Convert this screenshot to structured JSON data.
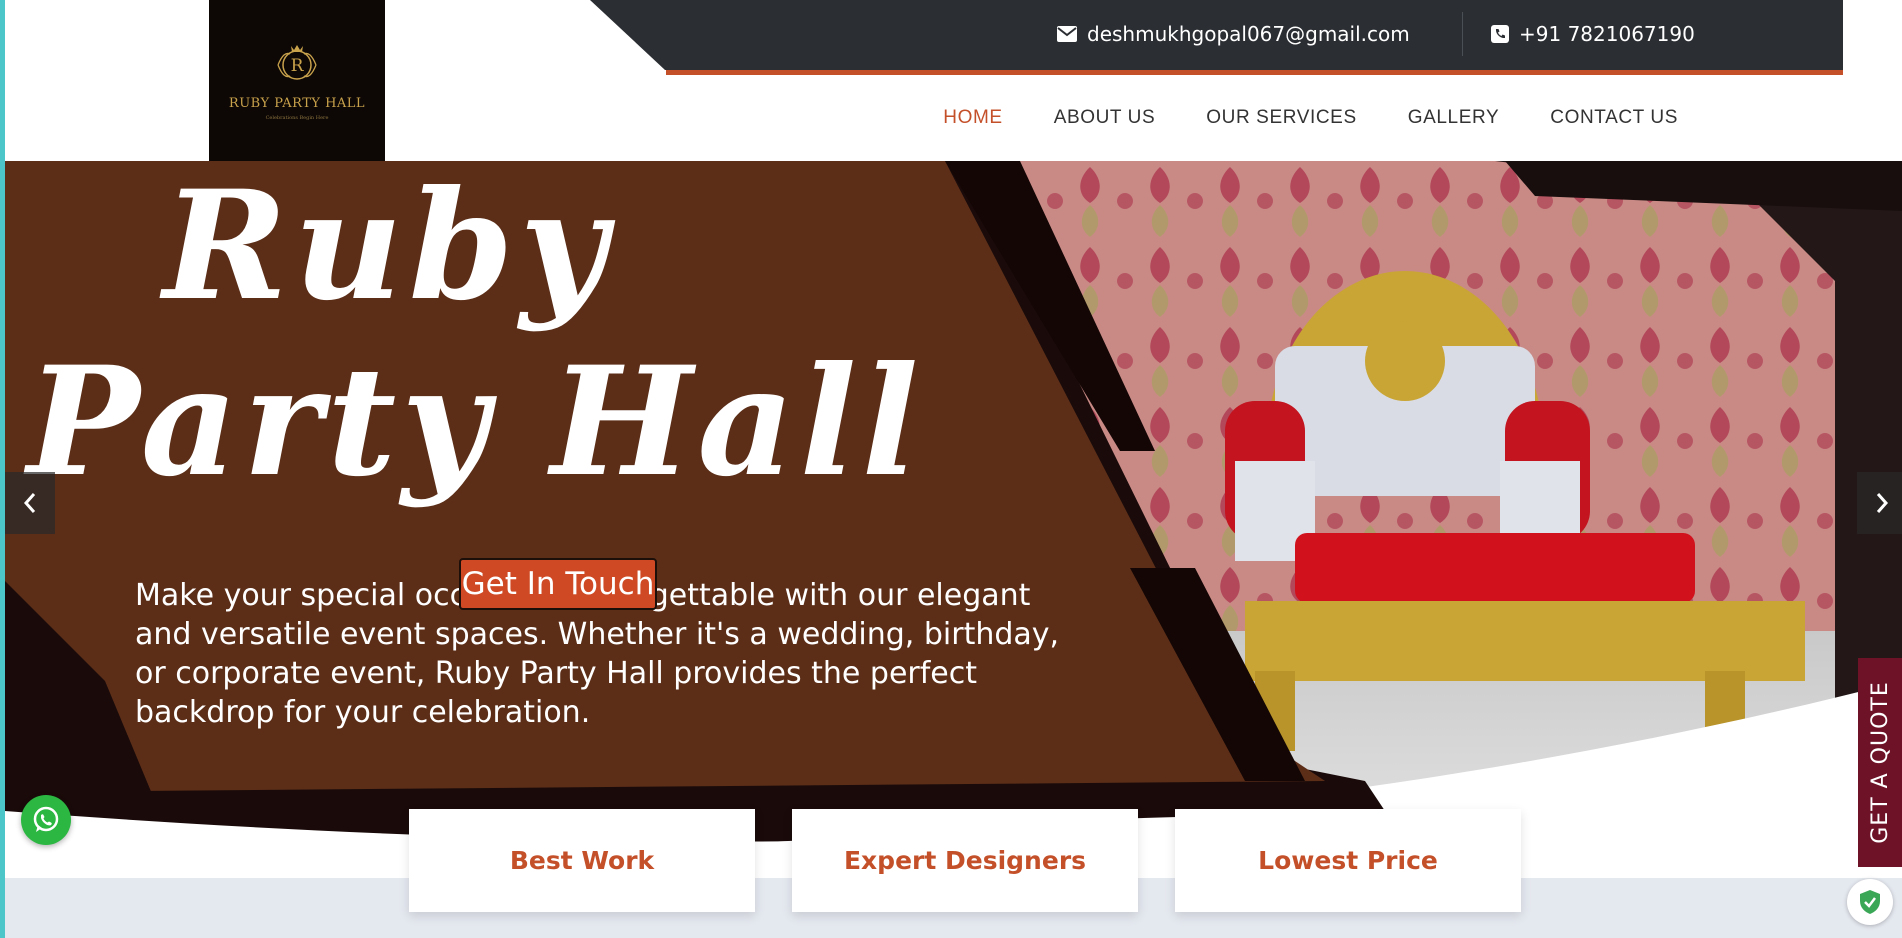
{
  "header": {
    "logo": {
      "name": "RUBY PARTY HALL",
      "tagline": "Celebrations Begin Here",
      "monogram": "R"
    },
    "email": "deshmukhgopal067@gmail.com",
    "phone": "+91 7821067190"
  },
  "nav": {
    "items": [
      {
        "label": "HOME",
        "active": true
      },
      {
        "label": "ABOUT US",
        "active": false
      },
      {
        "label": "OUR SERVICES",
        "active": false
      },
      {
        "label": "GALLERY",
        "active": false
      },
      {
        "label": "CONTACT US",
        "active": false
      }
    ]
  },
  "hero": {
    "title_line1": "Ruby",
    "title_line2": "Party Hall",
    "description": "Make your special occasions unforgettable with our elegant and versatile event spaces. Whether it's a wedding, birthday, or corporate event, Ruby Party Hall provides the perfect backdrop for your celebration.",
    "cta_label": "Get In Touch"
  },
  "features": [
    {
      "label": "Best Work"
    },
    {
      "label": "Expert Designers"
    },
    {
      "label": "Lowest Price"
    }
  ],
  "floating": {
    "quote_label": "GET A QUOTE"
  },
  "icons": {
    "email": "envelope-icon",
    "phone": "phone-icon",
    "prev": "chevron-left-icon",
    "next": "chevron-right-icon",
    "whatsapp": "whatsapp-icon",
    "shield": "shield-check-icon"
  },
  "colors": {
    "accent": "#c4502a",
    "topbar": "#2b2e33",
    "hero_brown": "#5c2e18",
    "quote_tab": "#6e1227",
    "whatsapp": "#2bb741"
  }
}
